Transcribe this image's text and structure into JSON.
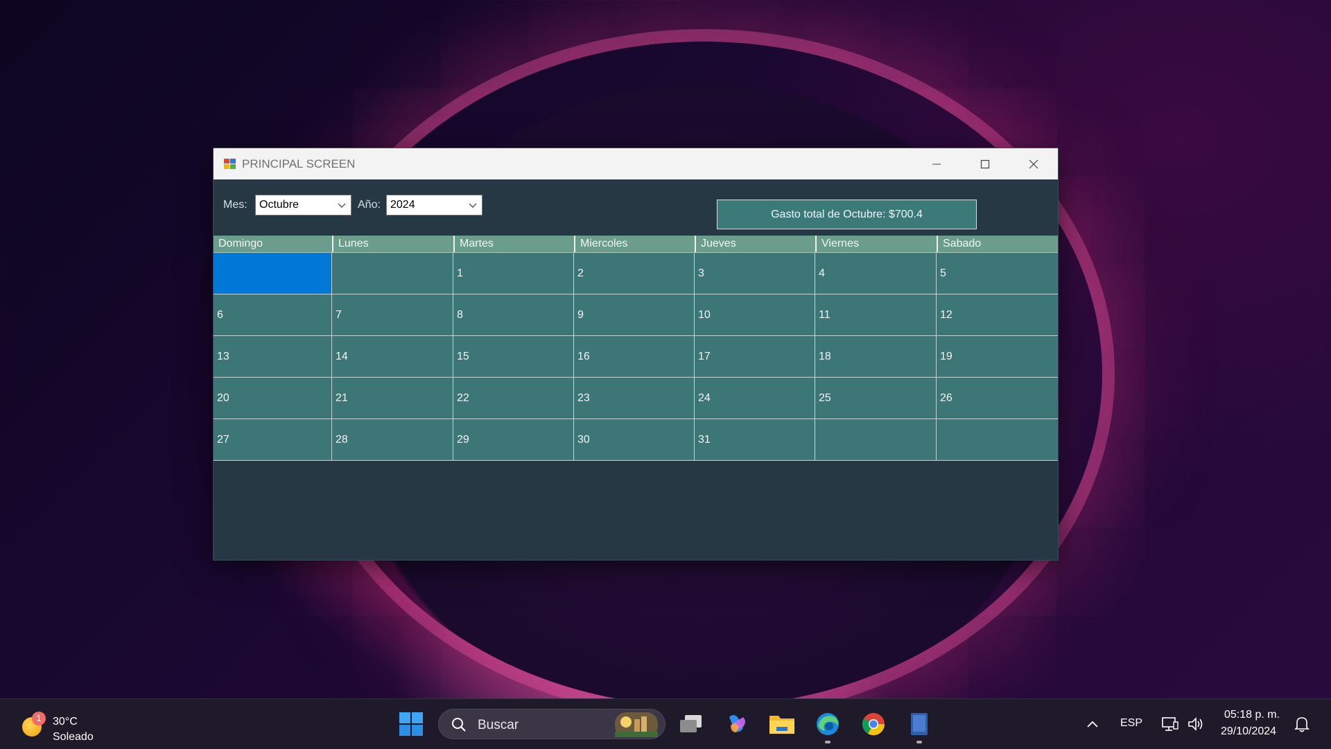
{
  "window": {
    "title": "PRINCIPAL SCREEN",
    "controls": [
      "minimize",
      "maximize",
      "close"
    ]
  },
  "toolbar": {
    "mes_label": "Mes:",
    "mes_value": "Octubre",
    "anio_label": "Año:",
    "anio_value": "2024",
    "total_button": "Gasto total de Octubre: $700.4"
  },
  "calendar": {
    "headers": [
      "Domingo",
      "Lunes",
      "Martes",
      "Miercoles",
      "Jueves",
      "Viernes",
      "Sabado"
    ],
    "rows": [
      [
        "",
        "",
        "1",
        "2",
        "3",
        "4",
        "5"
      ],
      [
        "6",
        "7",
        "8",
        "9",
        "10",
        "11",
        "12"
      ],
      [
        "13",
        "14",
        "15",
        "16",
        "17",
        "18",
        "19"
      ],
      [
        "20",
        "21",
        "22",
        "23",
        "24",
        "25",
        "26"
      ],
      [
        "27",
        "28",
        "29",
        "30",
        "31",
        "",
        ""
      ]
    ],
    "selected_cell": "row 1, Domingo"
  },
  "taskbar": {
    "weather_badge": "1",
    "weather_temp": "30°C",
    "weather_condition": "Soleado",
    "search_placeholder": "Buscar",
    "language": "ESP",
    "time": "05:18 p. m.",
    "date": "29/10/2024"
  },
  "colors": {
    "window_bg": "#253843",
    "cell_bg": "#3d7676",
    "header_bg": "#6a9d8c",
    "selected": "#0078d7"
  }
}
